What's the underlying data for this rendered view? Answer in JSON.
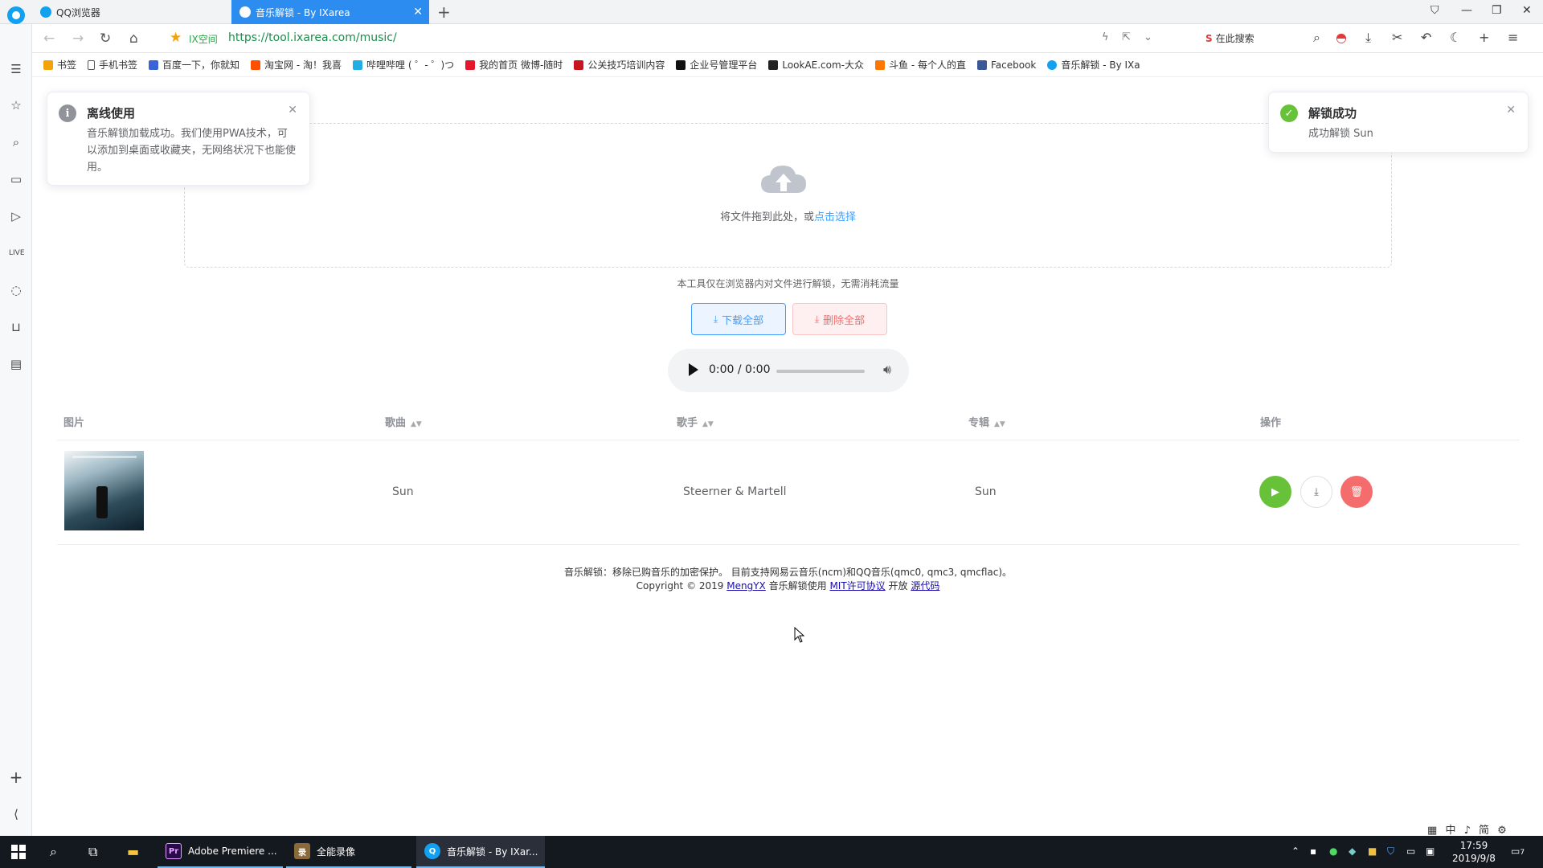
{
  "browser": {
    "tabs": [
      {
        "label": "QQ浏览器"
      },
      {
        "label": "音乐解锁 - By IXarea"
      }
    ],
    "ix_label": "IX空间",
    "url": "https://tool.ixarea.com/music/",
    "search_placeholder": "在此搜索",
    "bookmarks": [
      {
        "label": "书签",
        "color": "#f4a20a"
      },
      {
        "label": "手机书签",
        "color": "#ffffff"
      },
      {
        "label": "百度一下，你就知",
        "color": "#3b63d8"
      },
      {
        "label": "淘宝网 - 淘！我喜",
        "color": "#ff5000"
      },
      {
        "label": "哔哩哔哩 ( ゜- ゜)つ",
        "color": "#23ade5"
      },
      {
        "label": "我的首页 微博-随时",
        "color": "#e6162d"
      },
      {
        "label": "公关技巧培训内容",
        "color": "#c9151e"
      },
      {
        "label": "企业号管理平台",
        "color": "#111111"
      },
      {
        "label": "LookAE.com-大众",
        "color": "#222222"
      },
      {
        "label": "斗鱼 - 每个人的直",
        "color": "#ff7700"
      },
      {
        "label": "Facebook",
        "color": "#3b5998"
      },
      {
        "label": "音乐解锁 - By IXa",
        "color": "#12a0f0"
      }
    ]
  },
  "notifications": {
    "offline": {
      "title": "离线使用",
      "body": "音乐解锁加载成功。我们使用PWA技术，可以添加到桌面或收藏夹，无网络状况下也能使用。"
    },
    "success": {
      "title": "解锁成功",
      "body": "成功解锁 Sun"
    }
  },
  "upload": {
    "text": "将文件拖到此处，或",
    "link": "点击选择"
  },
  "hint": "本工具仅在浏览器内对文件进行解锁，无需消耗流量",
  "buttons": {
    "download_all": "下载全部",
    "delete_all": "删除全部"
  },
  "player": {
    "time": "0:00 / 0:00"
  },
  "table": {
    "headers": [
      "图片",
      "歌曲",
      "歌手",
      "专辑",
      "操作"
    ],
    "rows": [
      {
        "song": "Sun",
        "artist": "Steerner & Martell",
        "album": "Sun"
      }
    ]
  },
  "footer": {
    "line1": "音乐解锁：移除已购音乐的加密保护。 目前支持网易云音乐(ncm)和QQ音乐(qmc0, qmc3, qmcflac)。",
    "copyright": "Copyright © 2019",
    "author": "MengYX",
    "mid": "音乐解锁使用",
    "license": "MIT许可协议",
    "open": "开放",
    "source": "源代码"
  },
  "taskbar": {
    "apps": [
      {
        "label": "Adobe Premiere ...",
        "icon": "Pr",
        "color": "#2a0a4a"
      },
      {
        "label": "全能录像",
        "icon": "录",
        "color": "#8a6a3a"
      },
      {
        "label": "音乐解锁 - By IXar...",
        "icon": "Q",
        "color": "#12a0f0"
      }
    ],
    "time": "17:59",
    "date": "2019/9/8",
    "ime": "中 ♪ 简",
    "notification_count": "7"
  }
}
